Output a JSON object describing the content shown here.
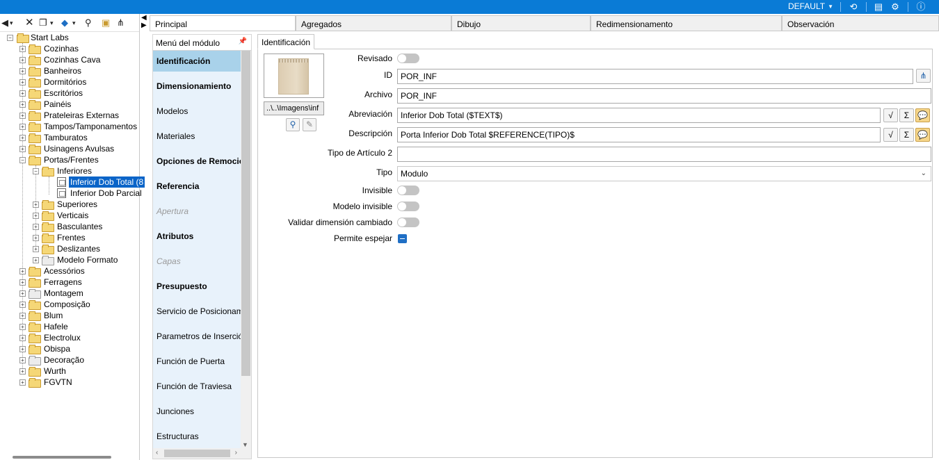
{
  "topbar": {
    "profile": "DEFAULT",
    "icons": [
      "refresh-icon",
      "layout-icon",
      "gear-icon",
      "help-icon"
    ],
    "accent": "#0a7bd6"
  },
  "tree_toolbar": {
    "icons": [
      "back-icon",
      "delete-icon",
      "copy-icon",
      "layers-icon",
      "binoculars-icon",
      "folder-search-icon",
      "tree-icon"
    ]
  },
  "tree": {
    "root": "Start Labs",
    "items": [
      "Cozinhas",
      "Cozinhas Cava",
      "Banheiros",
      "Dormitórios",
      "Escritórios",
      "Painéis",
      "Prateleiras Externas",
      "Tampos/Tamponamentos",
      "Tamburatos",
      "Usinagens Avulsas",
      "Portas/Frentes",
      "Inferiores",
      "Inferior Dob Total (8",
      "Inferior Dob Parcial",
      "Superiores",
      "Verticais",
      "Basculantes",
      "Frentes",
      "Deslizantes",
      "Modelo Formato",
      "Acessórios",
      "Ferragens",
      "Montagem",
      "Composição",
      "Blum",
      "Hafele",
      "Electrolux",
      "Obispa",
      "Decoração",
      "Wurth",
      "FGVTN"
    ]
  },
  "main_tabs": [
    "Principal",
    "Agregados",
    "Dibujo",
    "Redimensionamento",
    "Observación"
  ],
  "module_menu": {
    "title": "Menú del módulo",
    "items": [
      "Identificación",
      "Dimensionamiento",
      "Modelos",
      "Materiales",
      "Opciones de Remoción",
      "Referencia",
      "Apertura",
      "Atributos",
      "Capas",
      "Presupuesto",
      "Servicio de Posicionamiento",
      "Parametros de Inserción",
      "Función de Puerta",
      "Función de Traviesa",
      "Junciones",
      "Estructuras"
    ]
  },
  "identification": {
    "tab": "Identificación",
    "image_path": "..\\..\\Imagens\\inf",
    "labels": {
      "revisado": "Revisado",
      "id": "ID",
      "archivo": "Archivo",
      "abreviacion": "Abreviación",
      "descripcion": "Descripción",
      "tipo_articulo": "Tipo de Artículo 2",
      "tipo": "Tipo",
      "invisible": "Invisible",
      "modelo_invisible": "Modelo invisible",
      "validar": "Validar dimensión cambiado",
      "permite": "Permite espejar"
    },
    "values": {
      "id": "POR_INF",
      "archivo": "POR_INF",
      "abreviacion": "Inferior Dob Total ($TEXT$)",
      "descripcion": "Porta Inferior Dob Total $REFERENCE(TIPO)$",
      "tipo_articulo": "",
      "tipo": "Modulo"
    }
  }
}
